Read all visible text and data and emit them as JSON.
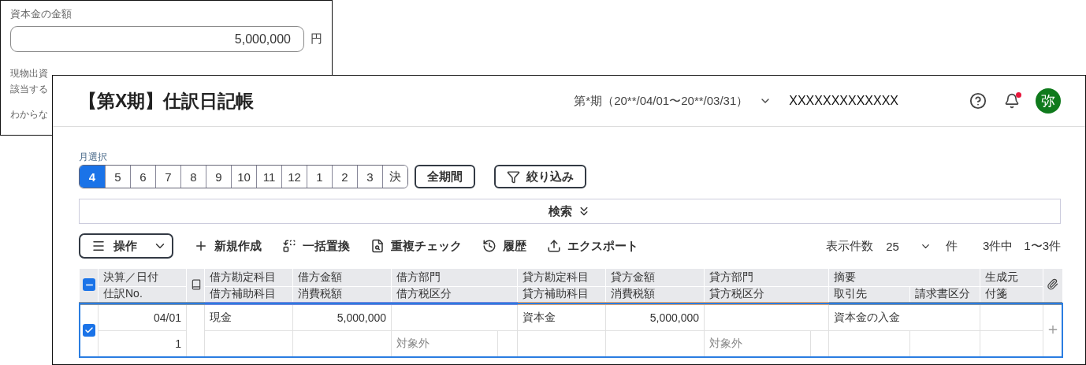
{
  "background_window": {
    "label": "資本金の金額",
    "amount": {
      "value": "5,000,000"
    },
    "unit": "円",
    "notes": [
      "現物出資",
      "該当する",
      "わからな"
    ]
  },
  "header": {
    "title": "【第X期】仕訳日記帳",
    "period": "第*期（20**/04/01〜20**/03/31）",
    "company": "XXXXXXXXXXXXX",
    "has_notification": true,
    "avatar": "弥"
  },
  "month_select": {
    "label": "月選択",
    "months": [
      {
        "label": "4",
        "selected": true
      },
      {
        "label": "5",
        "selected": false
      },
      {
        "label": "6",
        "selected": false
      },
      {
        "label": "7",
        "selected": false
      },
      {
        "label": "8",
        "selected": false
      },
      {
        "label": "9",
        "selected": false
      },
      {
        "label": "10",
        "selected": false
      },
      {
        "label": "11",
        "selected": false
      },
      {
        "label": "12",
        "selected": false
      },
      {
        "label": "1",
        "selected": false
      },
      {
        "label": "2",
        "selected": false
      },
      {
        "label": "3",
        "selected": false
      },
      {
        "label": "決",
        "selected": false
      }
    ],
    "all_period_button": "全期間",
    "filter_button": "絞り込み"
  },
  "search": {
    "label": "検索"
  },
  "toolbar": {
    "menu": "操作",
    "actions": [
      {
        "kind": "new",
        "label": "新規作成"
      },
      {
        "kind": "replace",
        "label": "一括置換"
      },
      {
        "kind": "duplicate",
        "label": "重複チェック"
      },
      {
        "kind": "history",
        "label": "履歴"
      },
      {
        "kind": "export",
        "label": "エクスポート"
      }
    ]
  },
  "pagination": {
    "per_page_label": "表示件数",
    "per_page": "25",
    "unit": "件",
    "total": "3件中",
    "range": "1〜3件"
  },
  "table": {
    "some_checked": true,
    "columns": [
      {
        "top": "決算／日付",
        "bottom": [
          "仕訳No."
        ],
        "color": "#8a949e"
      },
      {
        "top": "借方勘定科目",
        "bottom": [
          "借方補助科目"
        ],
        "color": "#7b86d9"
      },
      {
        "top": "借方金額",
        "bottom": [
          "消費税額"
        ],
        "color": "#7b86d9"
      },
      {
        "top": "借方部門",
        "bottom": [
          "借方税区分"
        ],
        "color": "#7b86d9"
      },
      {
        "top": "貸方勘定科目",
        "bottom": [
          "貸方補助科目"
        ],
        "color": "#eca86b"
      },
      {
        "top": "貸方金額",
        "bottom": [
          "消費税額"
        ],
        "color": "#eca86b"
      },
      {
        "top": "貸方部門",
        "bottom": [
          "貸方税区分"
        ],
        "color": "#eca86b"
      },
      {
        "top": "摘要",
        "bottom": [
          "取引先",
          "請求書区分"
        ],
        "color": "#8a949e"
      },
      {
        "top": "生成元",
        "bottom": [
          "付箋"
        ],
        "color": "#8a949e"
      }
    ],
    "rows": [
      {
        "checked": true,
        "date": "04/01",
        "no": "1",
        "debit_account": "現金",
        "debit_amount": "5,000,000",
        "debit_tax_class": "対象外",
        "credit_account": "資本金",
        "credit_amount": "5,000,000",
        "credit_tax_class": "対象外",
        "summary": "資本金の入金"
      }
    ]
  }
}
